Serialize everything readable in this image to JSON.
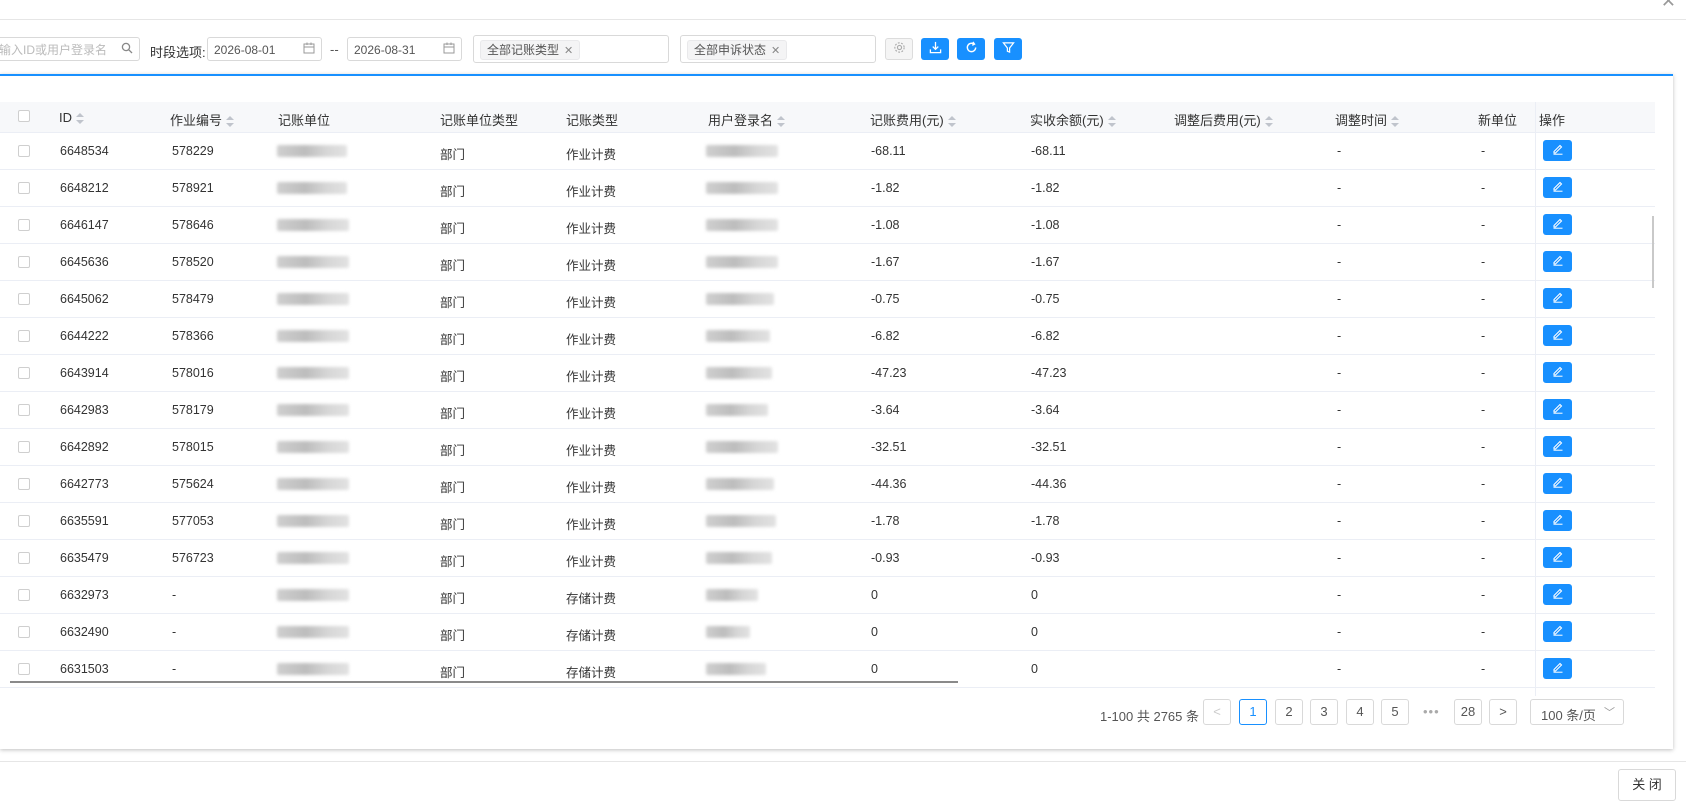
{
  "toolbar": {
    "search_placeholder": "输入ID或用户登录名",
    "period_label": "时段选项:",
    "date_start": "2026-08-01",
    "date_sep": "--",
    "date_end": "2026-08-31",
    "type_filter_tag": "全部记账类型",
    "status_filter_tag": "全部申诉状态"
  },
  "table": {
    "columns": [
      "ID",
      "作业编号",
      "记账单位",
      "记账单位类型",
      "记账类型",
      "用户登录名",
      "记账费用(元)",
      "实收余额(元)",
      "调整后费用(元)",
      "调整时间",
      "新单位",
      "操作"
    ],
    "rows": [
      {
        "id": "6648534",
        "job": "578229",
        "unit_type": "部门",
        "bill_type": "作业计费",
        "fee": "-68.11",
        "balance": "-68.11",
        "adj_time": "-",
        "new_unit": "-"
      },
      {
        "id": "6648212",
        "job": "578921",
        "unit_type": "部门",
        "bill_type": "作业计费",
        "fee": "-1.82",
        "balance": "-1.82",
        "adj_time": "-",
        "new_unit": "-"
      },
      {
        "id": "6646147",
        "job": "578646",
        "unit_type": "部门",
        "bill_type": "作业计费",
        "fee": "-1.08",
        "balance": "-1.08",
        "adj_time": "-",
        "new_unit": "-"
      },
      {
        "id": "6645636",
        "job": "578520",
        "unit_type": "部门",
        "bill_type": "作业计费",
        "fee": "-1.67",
        "balance": "-1.67",
        "adj_time": "-",
        "new_unit": "-"
      },
      {
        "id": "6645062",
        "job": "578479",
        "unit_type": "部门",
        "bill_type": "作业计费",
        "fee": "-0.75",
        "balance": "-0.75",
        "adj_time": "-",
        "new_unit": "-"
      },
      {
        "id": "6644222",
        "job": "578366",
        "unit_type": "部门",
        "bill_type": "作业计费",
        "fee": "-6.82",
        "balance": "-6.82",
        "adj_time": "-",
        "new_unit": "-"
      },
      {
        "id": "6643914",
        "job": "578016",
        "unit_type": "部门",
        "bill_type": "作业计费",
        "fee": "-47.23",
        "balance": "-47.23",
        "adj_time": "-",
        "new_unit": "-"
      },
      {
        "id": "6642983",
        "job": "578179",
        "unit_type": "部门",
        "bill_type": "作业计费",
        "fee": "-3.64",
        "balance": "-3.64",
        "adj_time": "-",
        "new_unit": "-"
      },
      {
        "id": "6642892",
        "job": "578015",
        "unit_type": "部门",
        "bill_type": "作业计费",
        "fee": "-32.51",
        "balance": "-32.51",
        "adj_time": "-",
        "new_unit": "-"
      },
      {
        "id": "6642773",
        "job": "575624",
        "unit_type": "部门",
        "bill_type": "作业计费",
        "fee": "-44.36",
        "balance": "-44.36",
        "adj_time": "-",
        "new_unit": "-"
      },
      {
        "id": "6635591",
        "job": "577053",
        "unit_type": "部门",
        "bill_type": "作业计费",
        "fee": "-1.78",
        "balance": "-1.78",
        "adj_time": "-",
        "new_unit": "-"
      },
      {
        "id": "6635479",
        "job": "576723",
        "unit_type": "部门",
        "bill_type": "作业计费",
        "fee": "-0.93",
        "balance": "-0.93",
        "adj_time": "-",
        "new_unit": "-"
      },
      {
        "id": "6632973",
        "job": "-",
        "unit_type": "部门",
        "bill_type": "存储计费",
        "fee": "0",
        "balance": "0",
        "adj_time": "-",
        "new_unit": "-"
      },
      {
        "id": "6632490",
        "job": "-",
        "unit_type": "部门",
        "bill_type": "存储计费",
        "fee": "0",
        "balance": "0",
        "adj_time": "-",
        "new_unit": "-"
      },
      {
        "id": "6631503",
        "job": "-",
        "unit_type": "部门",
        "bill_type": "存储计费",
        "fee": "0",
        "balance": "0",
        "adj_time": "-",
        "new_unit": "-"
      }
    ]
  },
  "pagination": {
    "total_text": "1-100 共 2765 条",
    "pages": [
      "1",
      "2",
      "3",
      "4",
      "5"
    ],
    "ellipsis": "•••",
    "last_page": "28",
    "page_size": "100 条/页",
    "prev": "<",
    "next": ">"
  },
  "footer": {
    "close_label": "关 闭"
  },
  "colors": {
    "primary": "#1890ff",
    "border": "#d9d9d9",
    "header_bg": "#f7f8fa"
  }
}
